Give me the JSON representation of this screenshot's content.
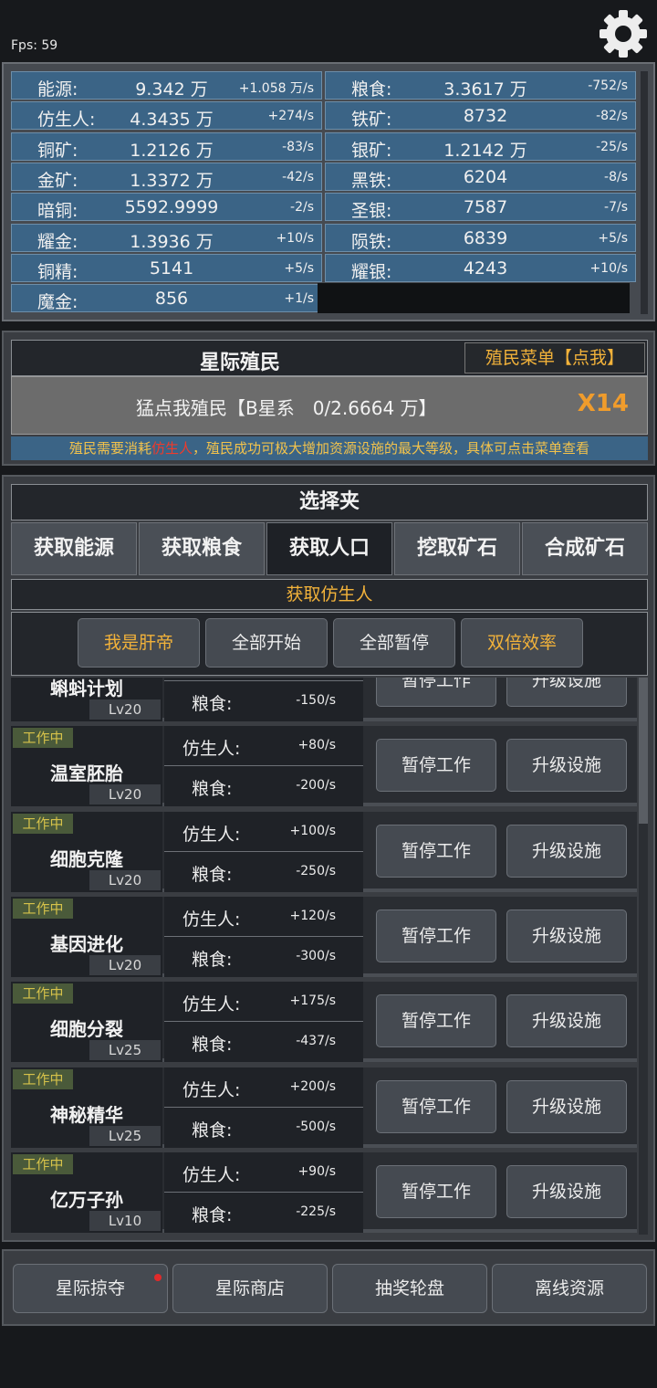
{
  "fps": "Fps:  59",
  "resources": [
    {
      "name": "能源:",
      "value": "9.342 万",
      "rate": "+1.058 万/s"
    },
    {
      "name": "粮食:",
      "value": "3.3617 万",
      "rate": "-752/s"
    },
    {
      "name": "仿生人:",
      "value": "4.3435 万",
      "rate": "+274/s"
    },
    {
      "name": "铁矿:",
      "value": "8732",
      "rate": "-82/s"
    },
    {
      "name": "铜矿:",
      "value": "1.2126 万",
      "rate": "-83/s"
    },
    {
      "name": "银矿:",
      "value": "1.2142 万",
      "rate": "-25/s"
    },
    {
      "name": "金矿:",
      "value": "1.3372 万",
      "rate": "-42/s"
    },
    {
      "name": "黑铁:",
      "value": "6204",
      "rate": "-8/s"
    },
    {
      "name": "暗铜:",
      "value": "5592.9999",
      "rate": "-2/s"
    },
    {
      "name": "圣银:",
      "value": "7587",
      "rate": "-7/s"
    },
    {
      "name": "耀金:",
      "value": "1.3936 万",
      "rate": "+10/s"
    },
    {
      "name": "陨铁:",
      "value": "6839",
      "rate": "+5/s"
    },
    {
      "name": "铜精:",
      "value": "5141",
      "rate": "+5/s"
    },
    {
      "name": "耀银:",
      "value": "4243",
      "rate": "+10/s"
    },
    {
      "name": "魔金:",
      "value": "856",
      "rate": "+1/s"
    }
  ],
  "colonize": {
    "title": "星际殖民",
    "menu": "殖民菜单【点我】",
    "button": "猛点我殖民【B星系　0/2.6664 万】",
    "multiplier": "X14",
    "note_a": "殖民需要消耗",
    "note_red": "仿生人",
    "note_b": "，殖民成功可极大增加资源设施的最大等级，具体可点击菜单查看"
  },
  "selector": {
    "title": "选择夹",
    "tabs": [
      "获取能源",
      "获取粮食",
      "获取人口",
      "挖取矿石",
      "合成矿石"
    ],
    "active_tab": 2,
    "subtitle": "获取仿生人",
    "actions": [
      {
        "label": "我是肝帝",
        "gold": true
      },
      {
        "label": "全部开始",
        "gold": false
      },
      {
        "label": "全部暂停",
        "gold": false
      },
      {
        "label": "双倍效率",
        "gold": true
      }
    ]
  },
  "facilities": [
    {
      "status": "",
      "name": "蝌蚪计划",
      "level": "Lv20",
      "k1": "",
      "v1": "",
      "k2": "粮食:",
      "v2": "-150/s",
      "pause": "暂停工作",
      "upgrade": "升级设施"
    },
    {
      "status": "工作中",
      "name": "温室胚胎",
      "level": "Lv20",
      "k1": "仿生人:",
      "v1": "+80/s",
      "k2": "粮食:",
      "v2": "-200/s",
      "pause": "暂停工作",
      "upgrade": "升级设施"
    },
    {
      "status": "工作中",
      "name": "细胞克隆",
      "level": "Lv20",
      "k1": "仿生人:",
      "v1": "+100/s",
      "k2": "粮食:",
      "v2": "-250/s",
      "pause": "暂停工作",
      "upgrade": "升级设施"
    },
    {
      "status": "工作中",
      "name": "基因进化",
      "level": "Lv20",
      "k1": "仿生人:",
      "v1": "+120/s",
      "k2": "粮食:",
      "v2": "-300/s",
      "pause": "暂停工作",
      "upgrade": "升级设施"
    },
    {
      "status": "工作中",
      "name": "细胞分裂",
      "level": "Lv25",
      "k1": "仿生人:",
      "v1": "+175/s",
      "k2": "粮食:",
      "v2": "-437/s",
      "pause": "暂停工作",
      "upgrade": "升级设施"
    },
    {
      "status": "工作中",
      "name": "神秘精华",
      "level": "Lv25",
      "k1": "仿生人:",
      "v1": "+200/s",
      "k2": "粮食:",
      "v2": "-500/s",
      "pause": "暂停工作",
      "upgrade": "升级设施"
    },
    {
      "status": "工作中",
      "name": "亿万子孙",
      "level": "Lv10",
      "k1": "仿生人:",
      "v1": "+90/s",
      "k2": "粮食:",
      "v2": "-225/s",
      "pause": "暂停工作",
      "upgrade": "升级设施"
    }
  ],
  "bottom_nav": [
    "星际掠夺",
    "星际商店",
    "抽奖轮盘",
    "离线资源"
  ],
  "icons": {
    "settings": "gear-icon",
    "notification": "red-dot"
  },
  "colors": {
    "accent": "#f2b23a",
    "resource_bg": "#3b6486",
    "warning": "#f03a2a",
    "multiplier": "#f09c2c"
  }
}
